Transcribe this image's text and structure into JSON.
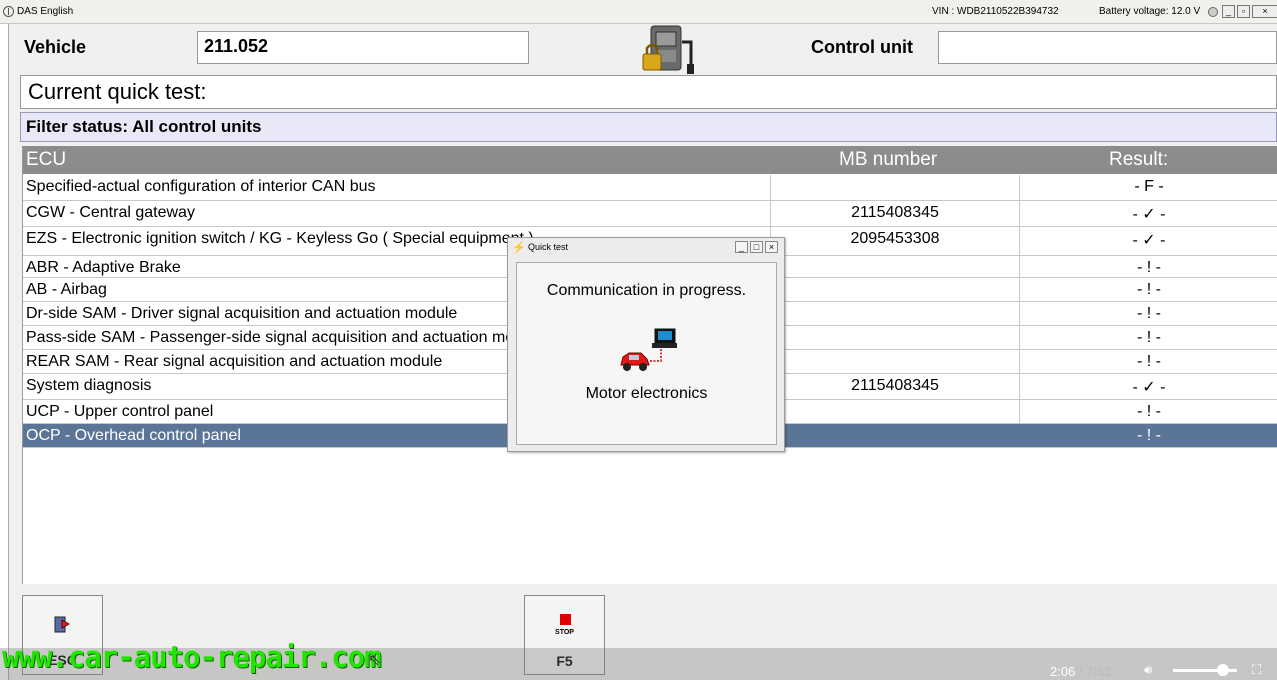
{
  "titlebar": {
    "app_name": "DAS English",
    "vin": "VIN : WDB2110522B394732",
    "battery": "Battery voltage: 12.0 V"
  },
  "header": {
    "vehicle_label": "Vehicle",
    "vehicle_value": "211.052",
    "control_unit_label": "Control unit",
    "control_unit_value": ""
  },
  "quick_test": {
    "label": "Current quick test:"
  },
  "filter": {
    "status": "Filter status: All control units"
  },
  "table": {
    "columns": [
      "ECU",
      "MB number",
      "Result:"
    ],
    "rows": [
      {
        "ecu": "Specified-actual configuration of interior CAN bus",
        "mb": "",
        "result": "- F -"
      },
      {
        "ecu": "CGW - Central gateway",
        "mb": "2115408345",
        "result": "- ✓ -"
      },
      {
        "ecu": "EZS - Electronic ignition switch / KG - Keyless Go ( Special equipment )",
        "mb": "2095453308",
        "result": "- ✓ -"
      },
      {
        "ecu": "ABR - Adaptive Brake",
        "mb": "",
        "result": "- ! -"
      },
      {
        "ecu": "AB - Airbag",
        "mb": "",
        "result": "- ! -"
      },
      {
        "ecu": "Dr-side SAM - Driver signal acquisition and actuation module",
        "mb": "",
        "result": "- ! -"
      },
      {
        "ecu": "Pass-side SAM - Passenger-side signal acquisition and actuation module",
        "mb": "",
        "result": "- ! -"
      },
      {
        "ecu": "REAR SAM - Rear signal acquisition and actuation module",
        "mb": "",
        "result": "- ! -"
      },
      {
        "ecu": "System diagnosis",
        "mb": "2115408345",
        "result": "- ✓ -"
      },
      {
        "ecu": "UCP - Upper control panel",
        "mb": "",
        "result": "- ! -"
      },
      {
        "ecu": "OCP - Overhead control panel",
        "mb": "",
        "result": "- ! -"
      }
    ],
    "selected_row": 10
  },
  "buttons": {
    "back_label": "ESC",
    "stop_text": "STOP",
    "stop_key": "F5"
  },
  "popup": {
    "title": "Quick test",
    "message": "Communication in progress.",
    "module": "Motor electronics"
  },
  "video": {
    "current": "2:06",
    "duration": "/ 7:52",
    "volume_level": 0.85
  },
  "watermark": "www.car-auto-repair.com",
  "colors": {
    "header_gray": "#8c8c8c",
    "selected_row": "#5a7596",
    "filter_bg": "#e8e8f8",
    "stop_red": "#e00000",
    "watermark_green": "#21e500"
  }
}
